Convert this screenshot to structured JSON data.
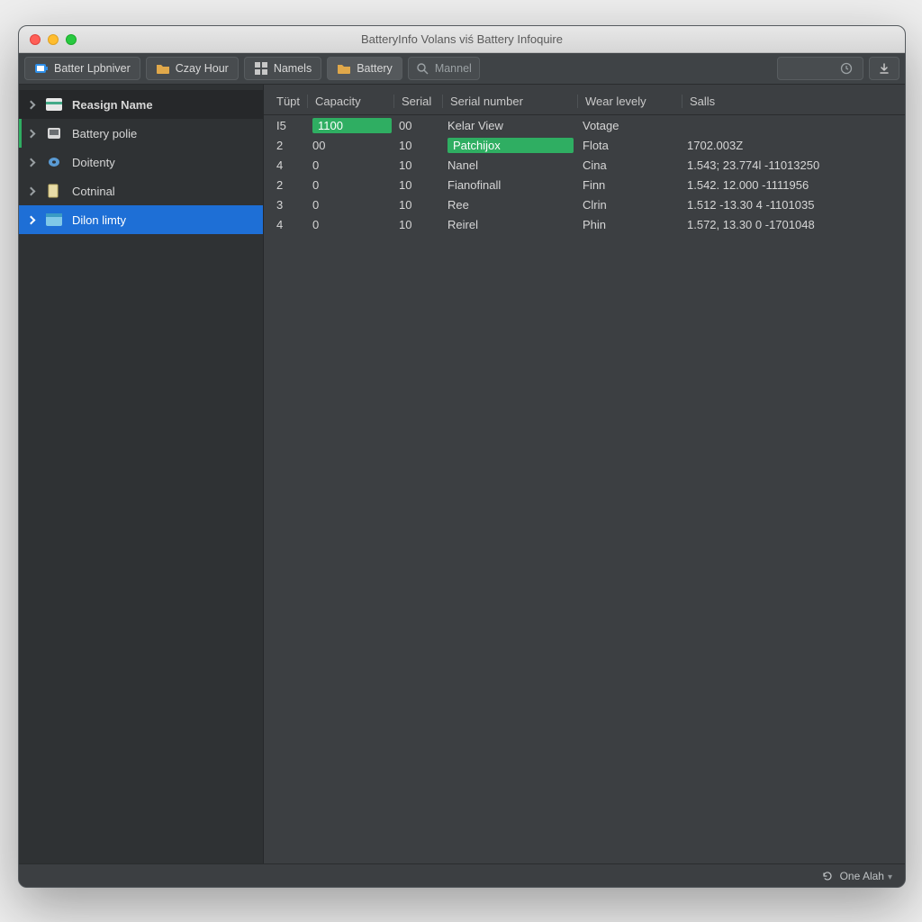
{
  "window": {
    "title": "BatteryInfo Volans viś Battery Infoquire"
  },
  "toolbar": {
    "items": [
      {
        "label": "Batter Lpbniver",
        "icon": "battery-icon",
        "color": "#2f8fe8"
      },
      {
        "label": "Czay Hour",
        "icon": "folder-icon",
        "color": "#e0a84a"
      },
      {
        "label": "Namels",
        "icon": "grid-icon",
        "color": "#c7c7c7"
      },
      {
        "label": "Battery",
        "icon": "folder-icon",
        "color": "#e0a84a"
      }
    ],
    "search_placeholder": "Mannel",
    "download_icon": "download-icon",
    "clock_icon": "clock-icon"
  },
  "sidebar": {
    "header": "Reasign Name",
    "items": [
      {
        "label": "Battery polie",
        "icon": "device-icon"
      },
      {
        "label": "Doitenty",
        "icon": "disk-icon"
      },
      {
        "label": "Cotninal",
        "icon": "page-icon"
      },
      {
        "label": "Dilon limty",
        "icon": "window-icon"
      }
    ]
  },
  "table": {
    "columns": [
      "Tüpt",
      "Capacity",
      "Serial",
      "Serial number",
      "Wear levely",
      "Salls"
    ],
    "rows": [
      {
        "c0": "I5",
        "c1": "1100",
        "c2": "00",
        "c3": "Kelar View",
        "c4": "Votage",
        "c5": ""
      },
      {
        "c0": "2",
        "c1": "00",
        "c2": "10",
        "c3": "Patchijox",
        "c4": "Flota",
        "c5": "1702.003Z"
      },
      {
        "c0": "4",
        "c1": "0",
        "c2": "10",
        "c3": "Nanel",
        "c4": "Cina",
        "c5": "1.543; 23.774l -11013250"
      },
      {
        "c0": "2",
        "c1": "0",
        "c2": "10",
        "c3": "Fianofinall",
        "c4": "Finn",
        "c5": "1.542. 12.000 -1111956"
      },
      {
        "c0": "3",
        "c1": "0",
        "c2": "10",
        "c3": "Ree",
        "c4": "Clrin",
        "c5": "1.512 -13.30 4 -1101035"
      },
      {
        "c0": "4",
        "c1": "0",
        "c2": "10",
        "c3": "Reirel",
        "c4": "Phin",
        "c5": "1.572, 13.30 0 -1701048"
      }
    ]
  },
  "status": {
    "text": "One Alah",
    "icon": "refresh-icon"
  }
}
